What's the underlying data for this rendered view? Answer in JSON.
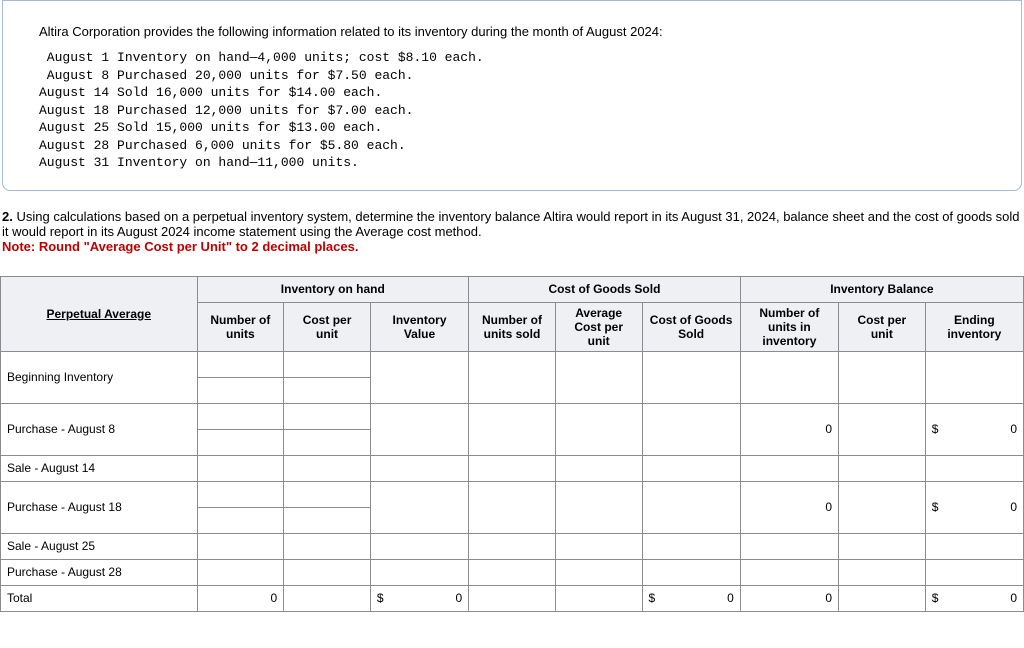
{
  "intro": "Altira Corporation provides the following information related to its inventory during the month of August 2024:",
  "txns": " August 1 Inventory on hand—4,000 units; cost $8.10 each.\n August 8 Purchased 20,000 units for $7.50 each.\nAugust 14 Sold 16,000 units for $14.00 each.\nAugust 18 Purchased 12,000 units for $7.00 each.\nAugust 25 Sold 15,000 units for $13.00 each.\nAugust 28 Purchased 6,000 units for $5.80 each.\nAugust 31 Inventory on hand—11,000 units.",
  "question": {
    "num": "2.",
    "body": "Using calculations based on a perpetual inventory system, determine the inventory balance Altira would report in its August 31, 2024, balance sheet and the cost of goods sold it would report in its August 2024 income statement using the Average cost method.",
    "note_label": "Note:",
    "note_body": "Round \"Average Cost per Unit\" to 2 decimal places."
  },
  "headers": {
    "pa": "Perpetual Average",
    "g1": "Inventory on hand",
    "g2": "Cost of Goods Sold",
    "g3": "Inventory Balance",
    "c1": "Number of units",
    "c2": "Cost per unit",
    "c3": "Inventory Value",
    "c4": "Number of units sold",
    "c5": "Average Cost per unit",
    "c6": "Cost of Goods Sold",
    "c7": "Number of units in inventory",
    "c8": "Cost per unit",
    "c9": "Ending inventory"
  },
  "rows": {
    "r0": "Beginning Inventory",
    "r1": "Purchase - August 8",
    "r2": "Sale - August 14",
    "r3": "Purchase - August 18",
    "r4": "Sale - August 25",
    "r5": "Purchase - August 28",
    "r6": "Total"
  },
  "vals": {
    "zero": "0",
    "dollar": "$"
  }
}
